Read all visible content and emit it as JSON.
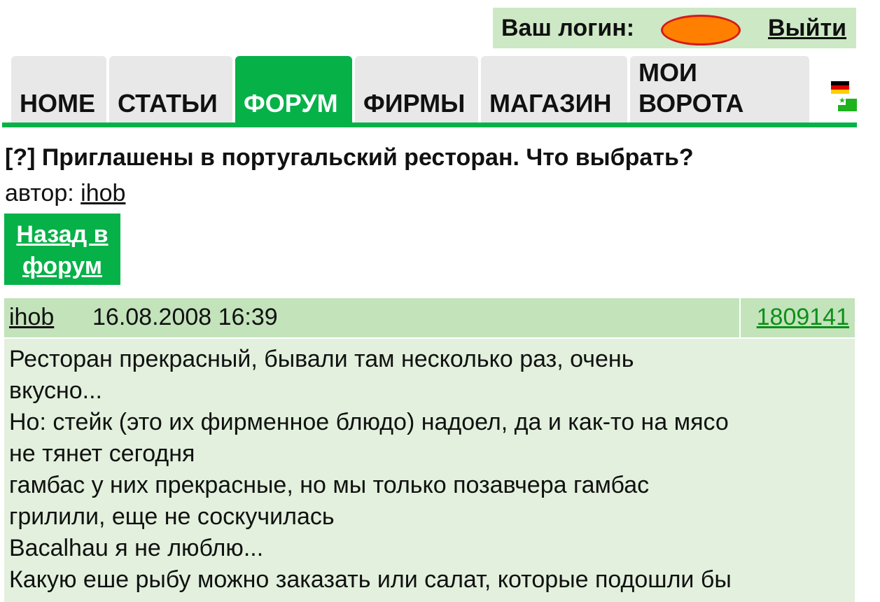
{
  "header": {
    "login_label": "Ваш логин:",
    "logout_label": "Выйти"
  },
  "tabs": [
    {
      "label": "HOME"
    },
    {
      "label": "СТАТЬИ"
    },
    {
      "label": "ФОРУМ",
      "active": true
    },
    {
      "label": "ФИРМЫ"
    },
    {
      "label": "МАГАЗИН"
    },
    {
      "label": "МОИ\nВОРОТА"
    }
  ],
  "colors": {
    "accent": "#06b148",
    "login_bg": "#cde8c5",
    "post_header_bg": "#c3e3bb",
    "post_body_bg": "#e2f0dd",
    "post_id_link": "#0d8f1a",
    "redaction_blob": "#ff7f00"
  },
  "thread": {
    "title": "[?] Приглашены в португальский ресторан. Что выбрать?",
    "author_prefix": "автор:",
    "author": "ihob",
    "back_button": "Назад в форум"
  },
  "post": {
    "author": "ihob",
    "date": "16.08.2008 16:39",
    "id": "1809141",
    "lines": [
      "Ресторан прекрасный, бывали там несколько раз, очень",
      "вкусно...",
      "Но: стейк (это их фирменное блюдо) надоел, да и как-то на мясо",
      "не тянет сегодня",
      "гамбас у них прекрасные, но мы только позавчера гамбас",
      "грилили, еще не соскучилась",
      "Bacalhau я не люблю...",
      "Какую еше рыбу можно заказать или салат, которые подошли бы"
    ]
  }
}
